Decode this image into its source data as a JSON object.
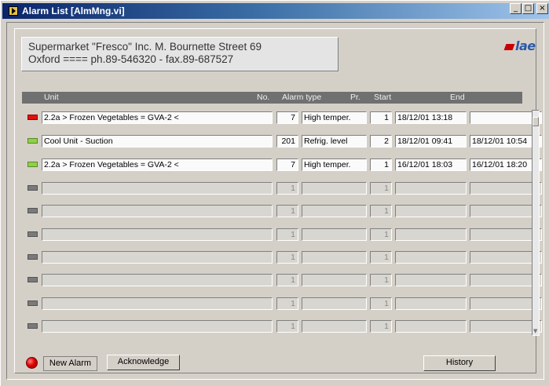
{
  "window": {
    "title": "Alarm List [AlmMng.vi]",
    "minimize": "_",
    "maximize": "□",
    "close": "×"
  },
  "company": {
    "line1": "Supermarket \"Fresco\" Inc.  M. Bournette Street 69",
    "line2": "Oxford   ====   ph.89-546320 - fax.89-687527"
  },
  "logo": {
    "text": "lae",
    "accent": "#cc0000",
    "brand": "#2a5aa8"
  },
  "columns": {
    "unit": "Unit",
    "no": "No.",
    "type": "Alarm type",
    "pr": "Pr.",
    "start": "Start",
    "end": "End"
  },
  "rows": [
    {
      "status": "red",
      "unit": "2.2a > Frozen Vegetables = GVA-2 <",
      "no": "7",
      "type": "High temper.",
      "pr": "1",
      "start": "18/12/01 13:18",
      "end": ""
    },
    {
      "status": "green",
      "unit": "Cool Unit - Suction",
      "no": "201",
      "type": "Refrig. level",
      "pr": "2",
      "start": "18/12/01 09:41",
      "end": "18/12/01 10:54"
    },
    {
      "status": "green",
      "unit": "2.2a > Frozen Vegetables = GVA-2 <",
      "no": "7",
      "type": "High temper.",
      "pr": "1",
      "start": "16/12/01 18:03",
      "end": "16/12/01 18:20"
    },
    {
      "status": "off",
      "unit": "",
      "no": "1",
      "type": "",
      "pr": "1",
      "start": "",
      "end": ""
    },
    {
      "status": "off",
      "unit": "",
      "no": "1",
      "type": "",
      "pr": "1",
      "start": "",
      "end": ""
    },
    {
      "status": "off",
      "unit": "",
      "no": "1",
      "type": "",
      "pr": "1",
      "start": "",
      "end": ""
    },
    {
      "status": "off",
      "unit": "",
      "no": "1",
      "type": "",
      "pr": "1",
      "start": "",
      "end": ""
    },
    {
      "status": "off",
      "unit": "",
      "no": "1",
      "type": "",
      "pr": "1",
      "start": "",
      "end": ""
    },
    {
      "status": "off",
      "unit": "",
      "no": "1",
      "type": "",
      "pr": "1",
      "start": "",
      "end": ""
    },
    {
      "status": "off",
      "unit": "",
      "no": "1",
      "type": "",
      "pr": "1",
      "start": "",
      "end": ""
    }
  ],
  "buttons": {
    "new_alarm": "New Alarm",
    "acknowledge": "Acknowledge",
    "history": "History"
  },
  "colors": {
    "alarm_active": "#e01010",
    "alarm_cleared": "#8ed04a",
    "alarm_off": "#7a7a7a"
  }
}
